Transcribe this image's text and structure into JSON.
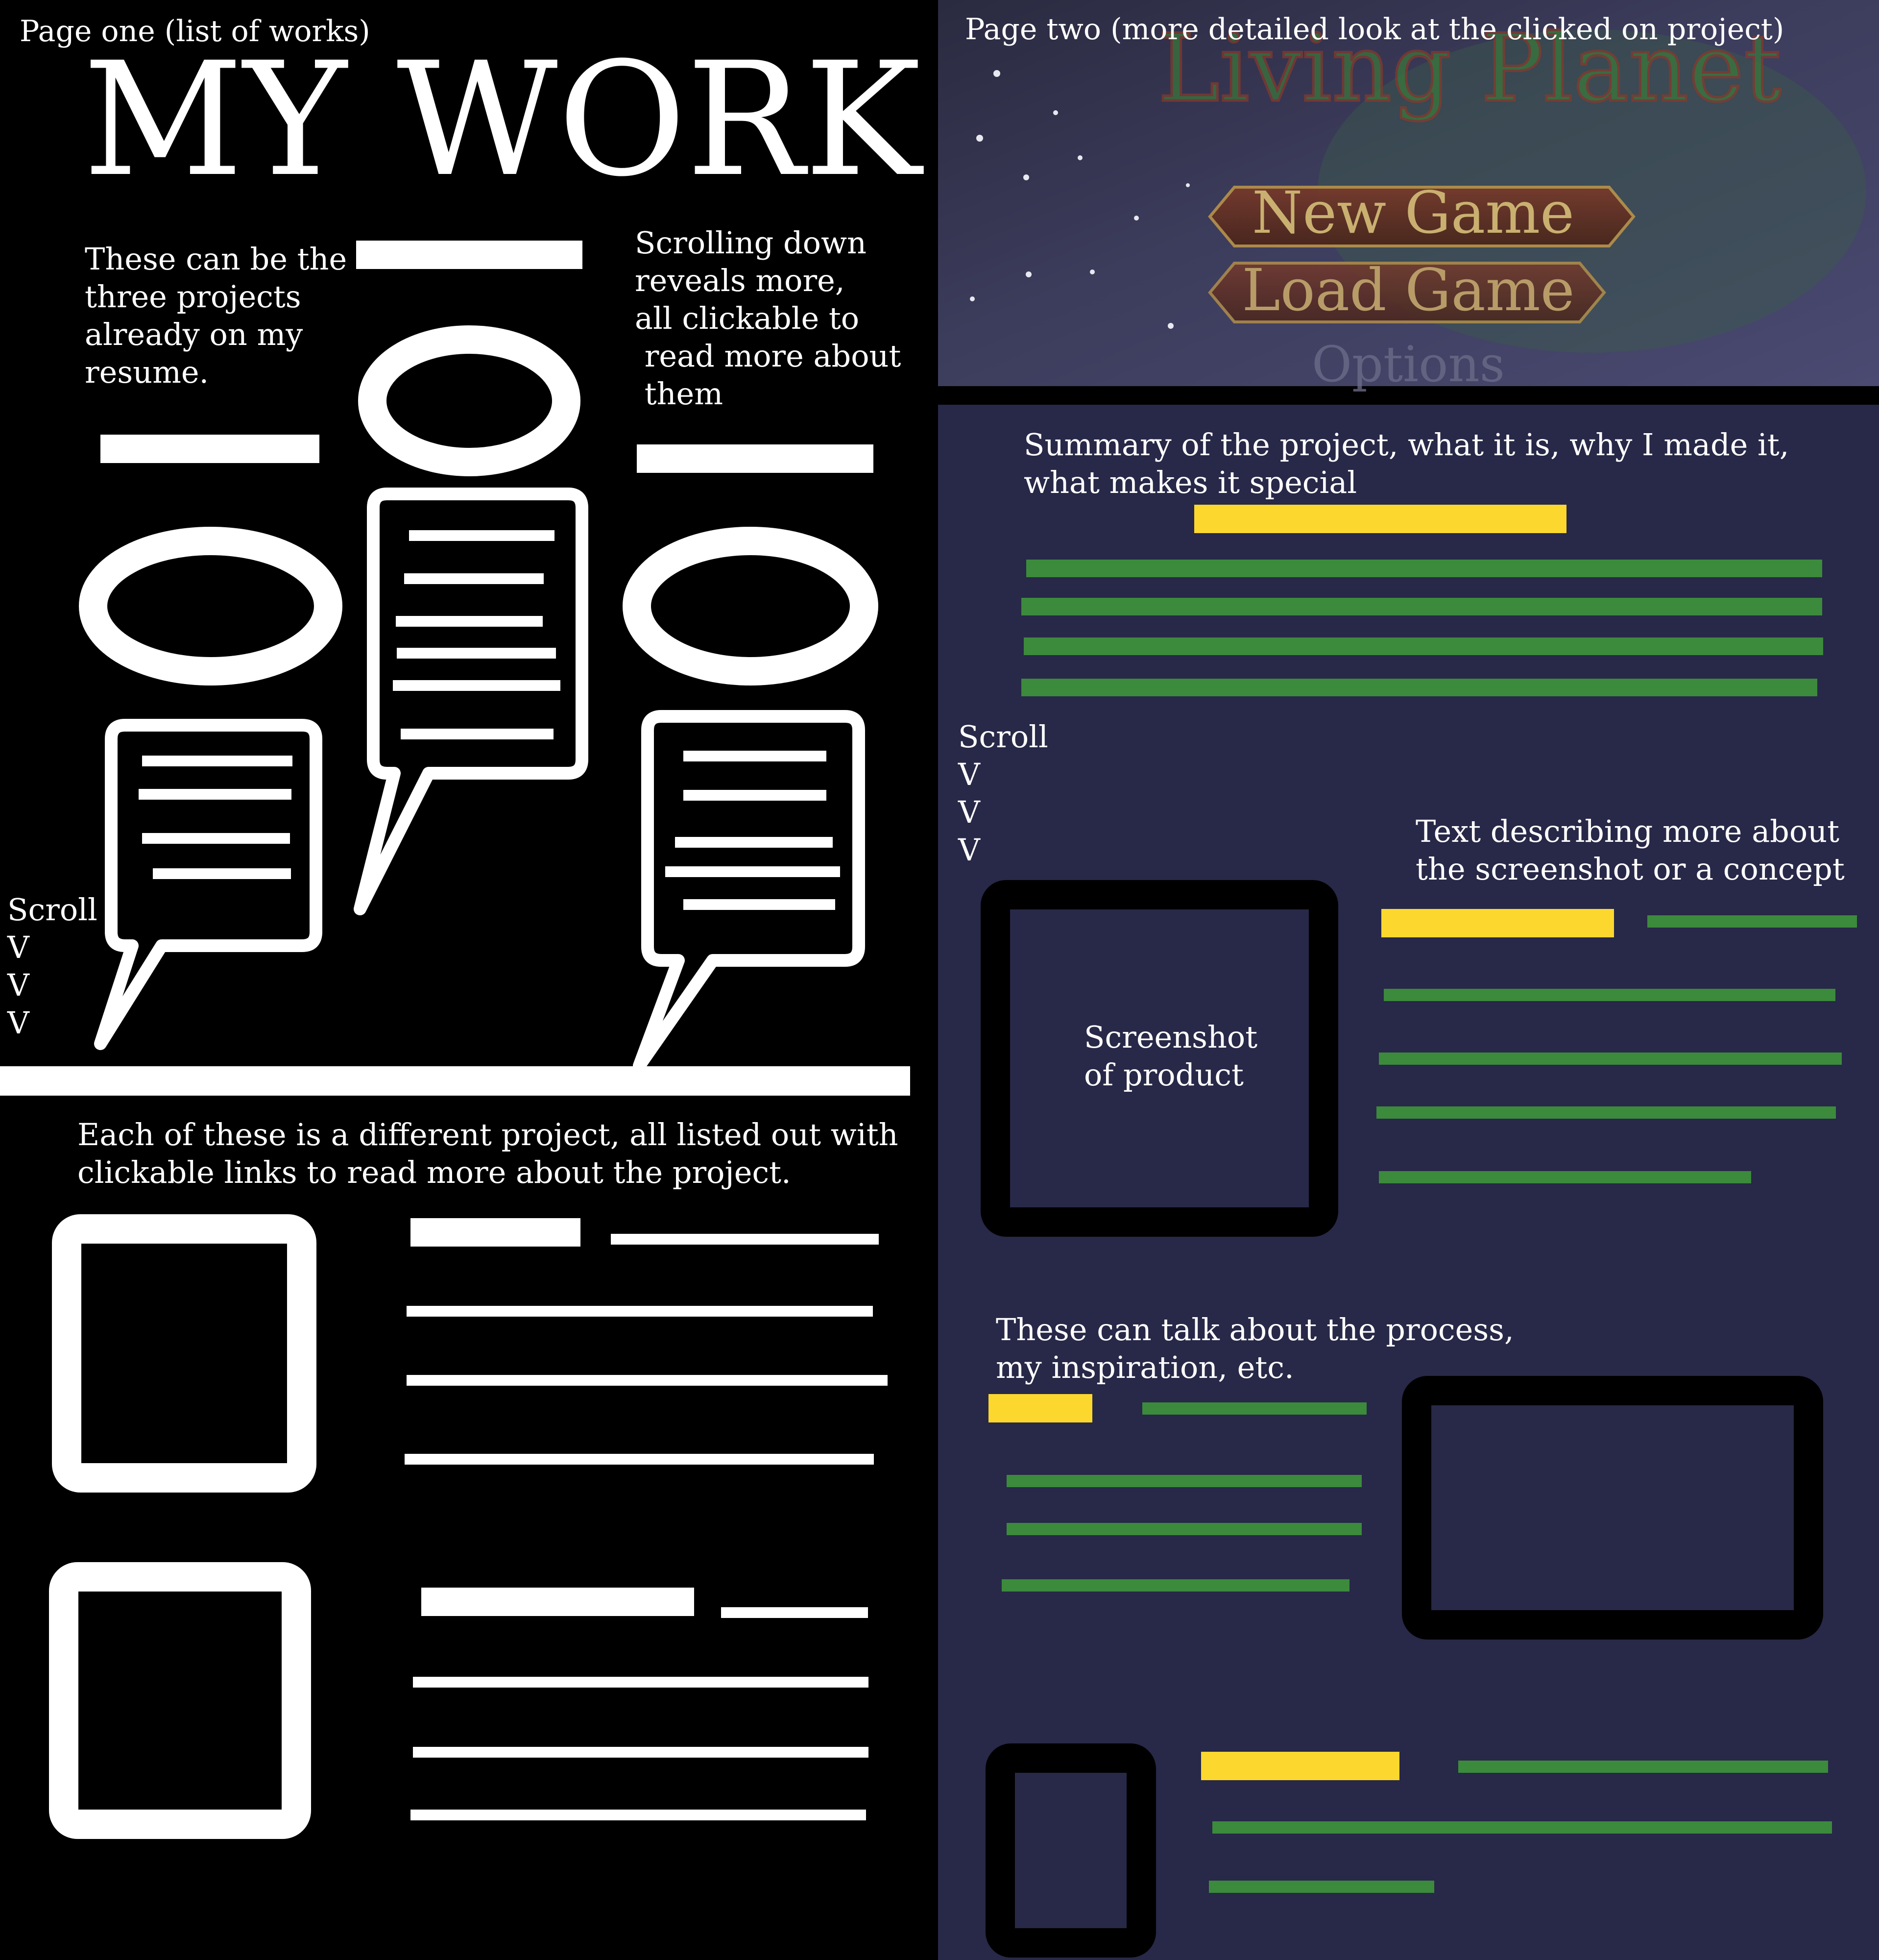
{
  "page_one": {
    "caption": "Page one (list of works)",
    "title": "MY WORK",
    "note_left": [
      "These can be the",
      "three projects",
      "already on my",
      "resume."
    ],
    "note_right": [
      "Scrolling down",
      "reveals more,",
      "all clickable to",
      " read more about",
      " them"
    ],
    "scroll": [
      "Scroll",
      "V",
      "V",
      "V"
    ],
    "list_note": [
      "Each of these is a different project, all listed out with",
      "clickable links to read more about the project."
    ]
  },
  "page_two": {
    "caption": "Page two (more detailed look at the clicked on project)",
    "hero": {
      "logo": "Living Planet",
      "menu": [
        "New Game",
        "Load Game",
        "Options"
      ]
    },
    "summary_note": [
      "Summary of the project, what it is, why I made it,",
      "what makes it special"
    ],
    "scroll": [
      "Scroll",
      "V",
      "V",
      "V"
    ],
    "screenshot_note": [
      "Text describing more about",
      "the screenshot or a concept"
    ],
    "screenshot_label": [
      "Screenshot",
      "of product"
    ],
    "process_note": [
      "These can talk about the process,",
      "my inspiration, etc."
    ]
  },
  "colors": {
    "background_one": "#000000",
    "background_two": "#282848",
    "placeholder_white": "#ffffff",
    "heading_bar": "#fcd82e",
    "text_bar": "#3c8a3c"
  }
}
